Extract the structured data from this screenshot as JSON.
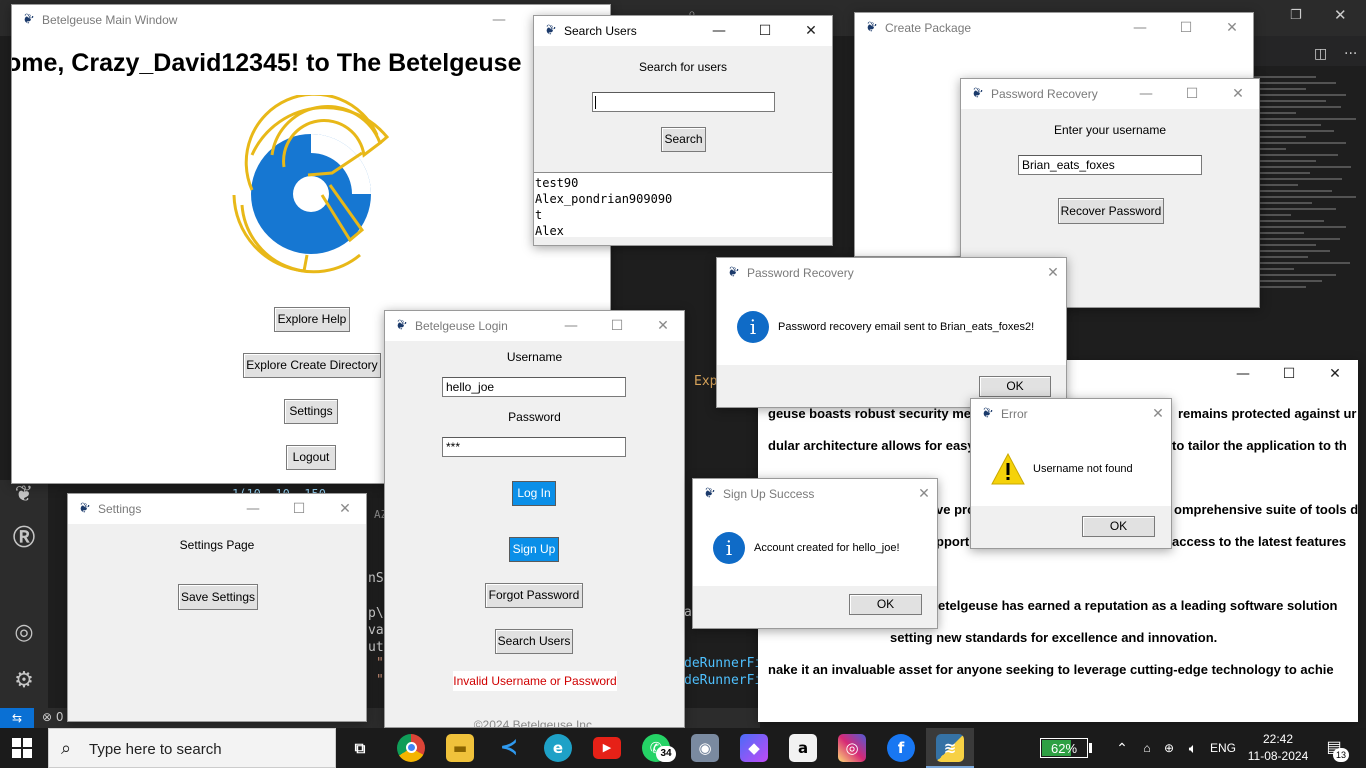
{
  "main_window": {
    "title": "Betelgeuse Main Window",
    "welcome": "ome, Crazy_David12345! to The Betelgeuse",
    "buttons": {
      "help": "Explore Help",
      "create_dir": "Explore Create Directory",
      "settings": "Settings",
      "logout": "Logout"
    }
  },
  "settings_window": {
    "title": "Settings",
    "heading": "Settings Page",
    "save": "Save Settings"
  },
  "login_window": {
    "title": "Betelgeuse Login",
    "username_label": "Username",
    "username_value": "hello_joe",
    "password_label": "Password",
    "password_value": "***",
    "login": "Log In",
    "signup": "Sign Up",
    "forgot": "Forgot Password",
    "search_users": "Search Users",
    "error": "Invalid Username or Password",
    "footer": "©2024 Betelgeuse Inc."
  },
  "search_window": {
    "title": "Search Users",
    "prompt": "Search for users",
    "search_value": "",
    "button": "Search",
    "results": [
      "test90",
      "Alex_pondrian909090",
      "t",
      "Alex"
    ]
  },
  "create_package_window": {
    "title": "Create Package"
  },
  "recovery_window": {
    "title": "Password Recovery",
    "prompt": "Enter your username",
    "value": "Brian_eats_foxes",
    "button": "Recover Password"
  },
  "recovery_msg": {
    "title": "Password Recovery",
    "text": "Password recovery email sent to Brian_eats_foxes2!",
    "ok": "OK"
  },
  "signup_msg": {
    "title": "Sign Up Success",
    "text": "Account created for hello_joe!",
    "ok": "OK"
  },
  "error_msg": {
    "title": "Error",
    "text": "Username not found",
    "ok": "OK"
  },
  "help_window": {
    "lines": [
      "geuse boasts robust security mea",
      "remains protected against ur",
      "dular architecture allows for easy",
      "to tailor the application to th",
      "ve pro",
      "omprehensive suite of tools d",
      "pport",
      "access to the latest features",
      "etelgeuse has earned a reputation as a leading software solution",
      "setting new standards for excellence and innovation.",
      "nake it an invaluable asset for anyone seeking to leverage cutting-edge technology to achie"
    ]
  },
  "editor_fragments": {
    "exp": "Exp",
    "az": "AZ",
    "so": "nSo",
    "p": "p\\",
    "vai": "vai",
    "ute": "ute",
    "q1": "\"",
    "q2": "\"",
    "runner1": "deRunnerFi",
    "runner2": "deRunnerFi",
    "a": "a",
    "num": "1(10, 10, 150",
    "status_zero": "0"
  },
  "taskbar": {
    "search_placeholder": "Type here to search",
    "battery": "62%",
    "lang": "ENG",
    "time": "22:42",
    "date": "11-08-2024",
    "notifications": "13",
    "whatsapp_badge": "34"
  },
  "colors": {
    "accent_blue": "#0a8fe8",
    "logo_blue": "#1677d2",
    "logo_gold": "#e8b818",
    "error_red": "#d00000"
  }
}
